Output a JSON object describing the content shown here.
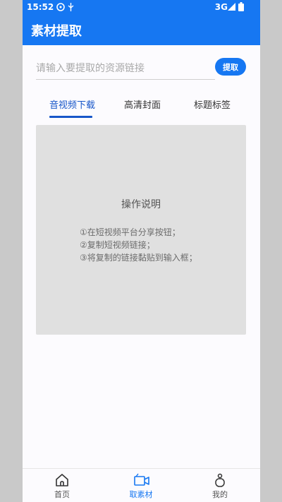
{
  "status_bar": {
    "time": "15:52",
    "network": "3G",
    "icons": [
      "notification-icon",
      "usb-icon",
      "signal-icon",
      "battery-icon"
    ]
  },
  "app_bar": {
    "title": "素材提取"
  },
  "search": {
    "placeholder": "请输入要提取的资源链接",
    "value": "",
    "button_label": "提取"
  },
  "tabs": [
    {
      "label": "音视频下载",
      "active": true
    },
    {
      "label": "高清封面",
      "active": false
    },
    {
      "label": "标题标签",
      "active": false
    }
  ],
  "instructions": {
    "heading": "操作说明",
    "steps": [
      "①在短视频平台分享按钮；",
      "②复制短视频链接；",
      "③将复制的链接黏贴到输入框；"
    ]
  },
  "bottom_nav": [
    {
      "label": "首页",
      "icon": "home-icon",
      "active": false
    },
    {
      "label": "取素材",
      "icon": "video-icon",
      "active": true
    },
    {
      "label": "我的",
      "icon": "profile-icon",
      "active": false
    }
  ],
  "colors": {
    "primary": "#1677f2",
    "tab_active": "#1756c9",
    "card_bg": "#e0e0e0",
    "page_bg": "#fcfbfe",
    "outer_bg": "#c9c9c9"
  }
}
